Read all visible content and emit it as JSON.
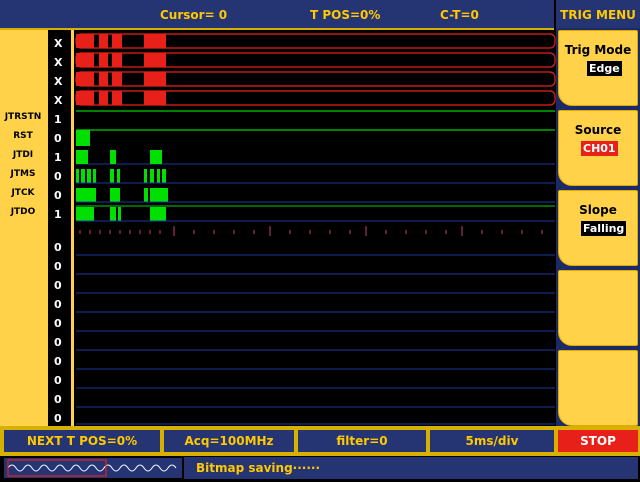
{
  "topbar": {
    "cursor": "Cursor= 0",
    "tpos": "T POS=0%",
    "ct": "C-T=0"
  },
  "menu": {
    "title": "TRIG MENU",
    "items": [
      {
        "label": "Trig Mode",
        "value": "Edge"
      },
      {
        "label": "Source",
        "value": "CH01"
      },
      {
        "label": "Slope",
        "value": "Falling"
      },
      {
        "label": "",
        "value": ""
      },
      {
        "label": "",
        "value": ""
      }
    ]
  },
  "signals": [
    "JTRSTN",
    "RST",
    "JTDI",
    "JTMS",
    "JTCK",
    "JTDO"
  ],
  "channel_values": [
    "X",
    "X",
    "X",
    "X",
    "1",
    "0",
    "1",
    "0",
    "0",
    "1",
    "0",
    "0",
    "0",
    "0",
    "0",
    "0",
    "0",
    "0",
    "0",
    "0"
  ],
  "bottom": {
    "next_tpos": "NEXT T POS=0%",
    "acq": "Acq=100MHz",
    "filter": "filter=0",
    "timebase": "5ms/div",
    "stop": "STOP"
  },
  "status": {
    "message": "Bitmap saving······"
  },
  "colors": {
    "accent": "#ffc800",
    "panel": "#253573",
    "trace": "#00e000",
    "undefined": "#e8201a",
    "stop": "#e8201a"
  }
}
